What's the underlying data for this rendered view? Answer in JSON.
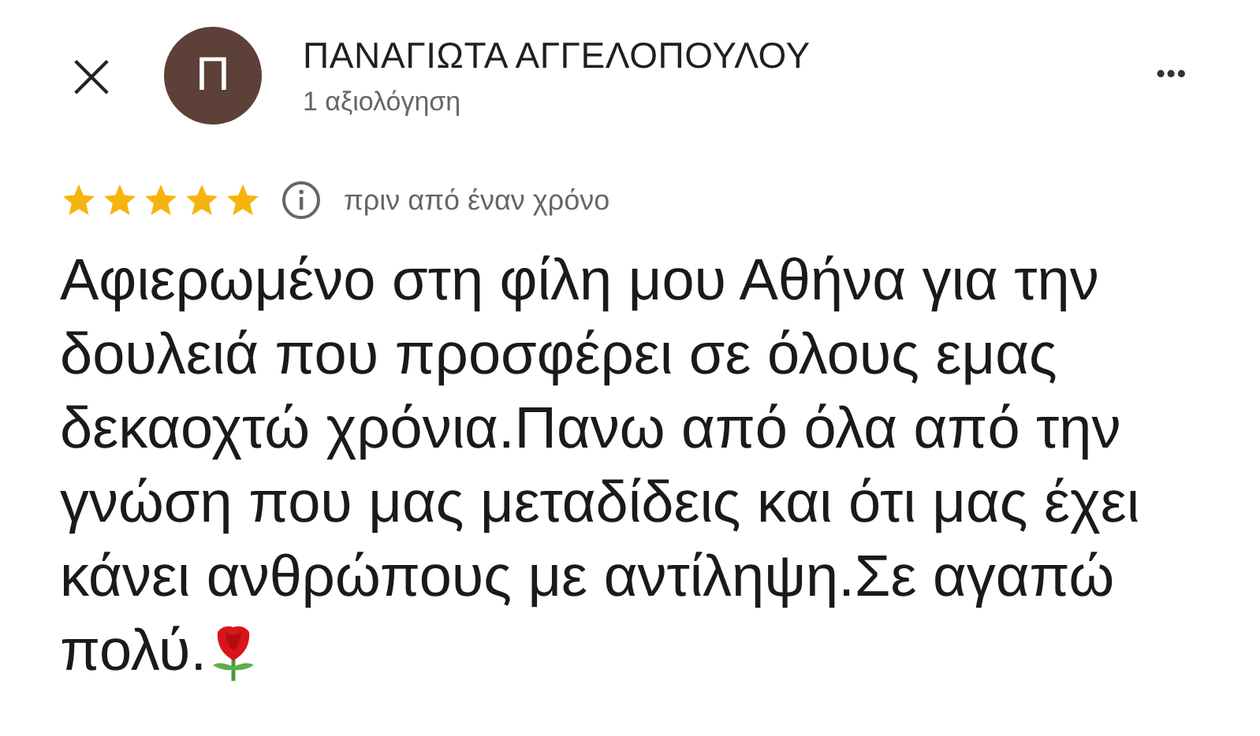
{
  "header": {
    "close": "×",
    "avatar_letter": "Π",
    "name": "ΠΑΝΑΓΙΩΤΑ ΑΓΓΕΛΟΠΟΥΛΟΥ",
    "review_count": "1 αξιολόγηση",
    "menu": "•••"
  },
  "review": {
    "stars": 5,
    "time": "πριν από έναν χρόνο",
    "text": "Αφιερωμένο στη φίλη μου Αθήνα για την δουλειά που προσφέρει σε όλους εμας δεκαοχτώ χρόνια.Πανω από όλα από την γνώση που μας μεταδίδεις και ότι μας έχει κάνει ανθρώπους με αντίληψη.Σε αγαπώ πολύ."
  }
}
